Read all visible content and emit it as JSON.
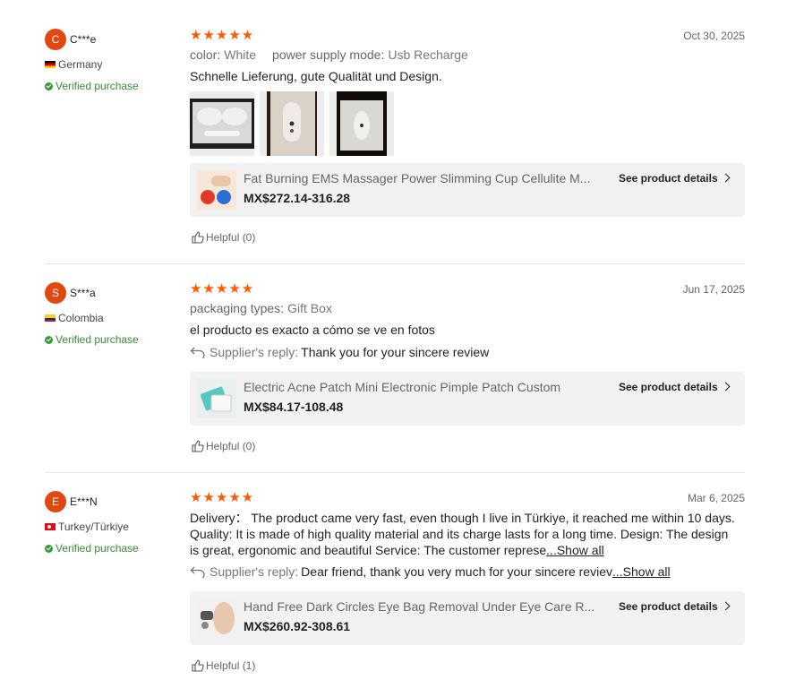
{
  "reviews": [
    {
      "avatar_letter": "C",
      "username": "C***e",
      "country": "Germany",
      "verified": "Verified purchase",
      "stars": "★★★★★",
      "date": "Oct 30, 2025",
      "attrs": [
        {
          "label": "color:",
          "value": "White"
        },
        {
          "label": "power supply mode:",
          "value": "Usb Recharge"
        }
      ],
      "text": "Schnelle Lieferung, gute Qualität und Design.",
      "product": {
        "title": "Fat Burning EMS Massager Power Slimming Cup Cellulite M...",
        "price": "MX$272.14-316.28",
        "details": "See product details"
      },
      "helpful": "Helpful (0)"
    },
    {
      "avatar_letter": "S",
      "username": "S***a",
      "country": "Colombia",
      "verified": "Verified purchase",
      "stars": "★★★★★",
      "date": "Jun 17, 2025",
      "attrs": [
        {
          "label": "packaging types:",
          "value": "Gift Box"
        }
      ],
      "text": "el producto es exacto a cómo se ve en fotos",
      "reply_label": "Supplier's reply:",
      "reply_text": "Thank you for your sincere review",
      "product": {
        "title": "Electric Acne Patch Mini Electronic Pimple Patch Custom",
        "price": "MX$84.17-108.48",
        "details": "See product details"
      },
      "helpful": "Helpful (0)"
    },
    {
      "avatar_letter": "E",
      "username": "E***N",
      "country": "Turkey/Türkiye",
      "verified": "Verified purchase",
      "stars": "★★★★★",
      "date": "Mar 6, 2025",
      "text": "Delivery： The product came very fast, even though I live in Türkiye, it reached me within 10 days. Quality: It is made of high quality material and its charge lasts for a long time. Design: The design is great, ergonomic and beautiful Service: The customer represe",
      "show_all": "...Show all",
      "reply_label": "Supplier's reply:",
      "reply_text": "Dear friend, thank you very much for your sincere reviev",
      "reply_show_all": "...Show all",
      "product": {
        "title": "Hand Free Dark Circles Eye Bag Removal Under Eye Care R...",
        "price": "MX$260.92-308.61",
        "details": "See product details"
      },
      "helpful": "Helpful (1)"
    }
  ],
  "colors": {
    "accent": "#ff5a00",
    "avatar": "#e2470f",
    "verified": "#3a8a3a"
  }
}
